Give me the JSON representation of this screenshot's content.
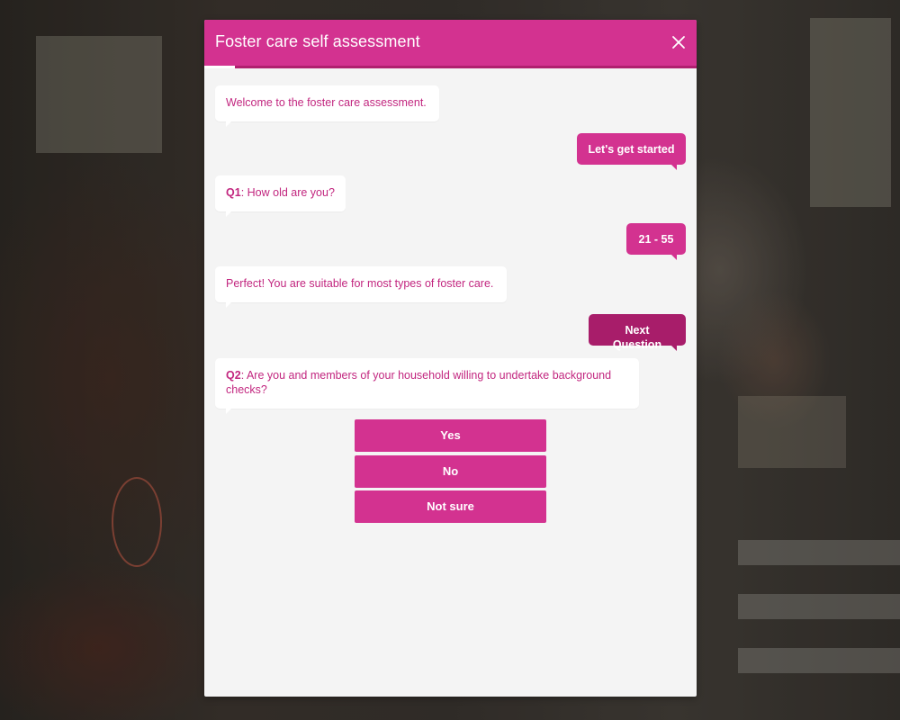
{
  "modal": {
    "title": "Foster care self assessment",
    "close_icon": "close-icon",
    "accent_color": "#d33290",
    "accent_dark_color": "#a81d6a"
  },
  "messages": [
    {
      "from": "bot",
      "text": "Welcome to the foster care assessment."
    },
    {
      "from": "user",
      "text": "Let's get started"
    },
    {
      "from": "bot",
      "question_number": "Q1",
      "text": ": How old are you?"
    },
    {
      "from": "user",
      "text": "21 - 55"
    },
    {
      "from": "bot",
      "text": "Perfect! You are suitable for most types of foster care."
    },
    {
      "from": "user",
      "text": "Next Question"
    },
    {
      "from": "bot",
      "question_number": "Q2",
      "text": ": Are you and members of your household willing to undertake background checks?"
    }
  ],
  "options": [
    {
      "label": "Yes"
    },
    {
      "label": "No"
    },
    {
      "label": "Not sure"
    }
  ]
}
